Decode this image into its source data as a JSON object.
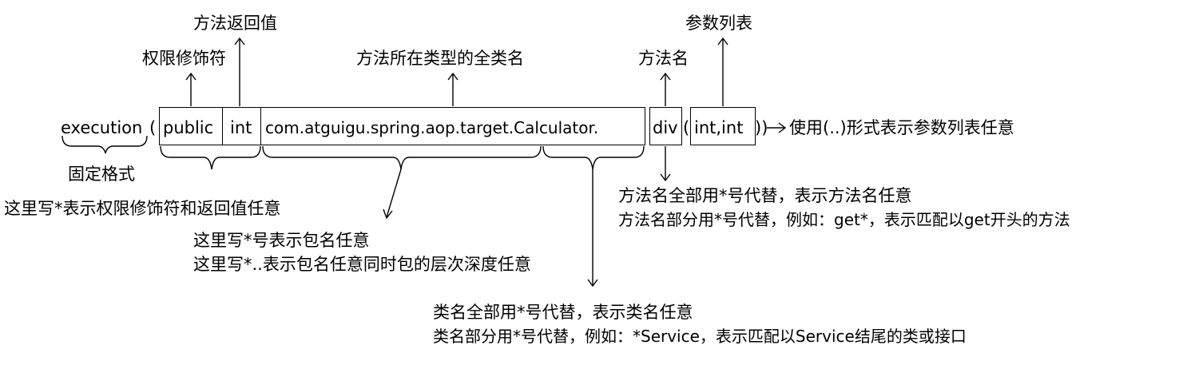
{
  "expression": {
    "execution": "execution",
    "open_paren": "(",
    "modifier": "public",
    "return_type": "int",
    "declaring_type": "com.atguigu.spring.aop.target.Calculator.",
    "method_name": "div",
    "params_open": "(",
    "params": "int,int",
    "close_parens": "))"
  },
  "labels": {
    "return_value": "方法返回值",
    "modifier": "权限修饰符",
    "full_class_name": "方法所在类型的全类名",
    "method_name": "方法名",
    "param_list": "参数列表",
    "fixed_format": "固定格式",
    "params_any": "使用(..)形式表示参数列表任意"
  },
  "notes": {
    "modifier_return_any": "这里写*表示权限修饰符和返回值任意",
    "package_line1": "这里写*号表示包名任意",
    "package_line2": "这里写*..表示包名任意同时包的层次深度任意",
    "class_line1": "类名全部用*号代替，表示类名任意",
    "class_line2": "类名部分用*号代替，例如：*Service，表示匹配以Service结尾的类或接口",
    "method_line1": "方法名全部用*号代替，表示方法名任意",
    "method_line2": "方法名部分用*号代替，例如：get*，表示匹配以get开头的方法"
  }
}
